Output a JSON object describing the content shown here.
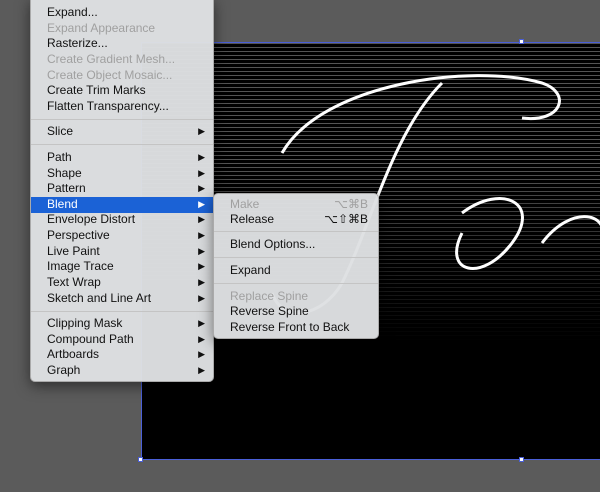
{
  "main_menu": {
    "items": [
      {
        "label": "Expand...",
        "disabled": false
      },
      {
        "label": "Expand Appearance",
        "disabled": true
      },
      {
        "label": "Rasterize...",
        "disabled": false
      },
      {
        "label": "Create Gradient Mesh...",
        "disabled": true
      },
      {
        "label": "Create Object Mosaic...",
        "disabled": true
      },
      {
        "label": "Create Trim Marks",
        "disabled": false
      },
      {
        "label": "Flatten Transparency...",
        "disabled": false
      },
      {
        "label": "Slice",
        "submenu": true
      },
      {
        "label": "Path",
        "submenu": true
      },
      {
        "label": "Shape",
        "submenu": true
      },
      {
        "label": "Pattern",
        "submenu": true
      },
      {
        "label": "Blend",
        "submenu": true,
        "selected": true
      },
      {
        "label": "Envelope Distort",
        "submenu": true
      },
      {
        "label": "Perspective",
        "submenu": true
      },
      {
        "label": "Live Paint",
        "submenu": true
      },
      {
        "label": "Image Trace",
        "submenu": true
      },
      {
        "label": "Text Wrap",
        "submenu": true
      },
      {
        "label": "Sketch and Line Art",
        "submenu": true
      },
      {
        "label": "Clipping Mask",
        "submenu": true
      },
      {
        "label": "Compound Path",
        "submenu": true
      },
      {
        "label": "Artboards",
        "submenu": true
      },
      {
        "label": "Graph",
        "submenu": true
      }
    ],
    "arrow": "▶"
  },
  "blend_menu": {
    "items": [
      {
        "label": "Make",
        "shortcut": "⌥⌘B",
        "disabled": true
      },
      {
        "label": "Release",
        "shortcut": "⌥⇧⌘B"
      },
      {
        "label": "Blend Options..."
      },
      {
        "label": "Expand"
      },
      {
        "label": "Replace Spine",
        "disabled": true
      },
      {
        "label": "Reverse Spine"
      },
      {
        "label": "Reverse Front to Back"
      }
    ]
  },
  "colors": {
    "highlight": "#1b62d6",
    "selection": "#4a5fd8"
  }
}
